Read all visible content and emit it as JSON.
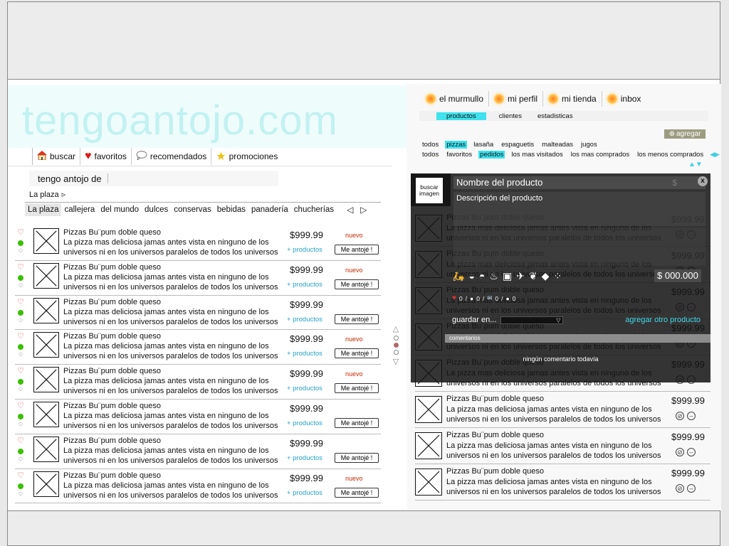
{
  "site": {
    "logo": "tengoantojo.com"
  },
  "nav": [
    {
      "label": "buscar",
      "icon": "home-icon"
    },
    {
      "label": "favoritos",
      "icon": "heart-icon"
    },
    {
      "label": "recomendados",
      "icon": "speech-bubble-icon"
    },
    {
      "label": "promociones",
      "icon": "star-icon"
    }
  ],
  "antojo": {
    "label": "tengo antojo de",
    "value": ""
  },
  "plaza": {
    "label": "La plaza",
    "arrow": "▹"
  },
  "categories": [
    "La plaza",
    "callejera",
    "del mundo",
    "dulces",
    "conservas",
    "bebidas",
    "panadería",
    "chucherías"
  ],
  "category_arrows": {
    "prev": "◁",
    "next": "▷"
  },
  "product": {
    "title": "Pizzas Bu¨pum doble queso",
    "desc": "La pizza mas deliciosa jamas antes vista en ninguno de los universos ni en los universos paralelos de todos los universos",
    "price": "$999.99",
    "plus": "+ productos",
    "nuevo": "nuevo",
    "antoje": "Me antojé !"
  },
  "left_rows": [
    {
      "nuevo": true
    },
    {
      "nuevo": true
    },
    {
      "nuevo": false
    },
    {
      "nuevo": true
    },
    {
      "nuevo": true
    },
    {
      "nuevo": false
    },
    {
      "nuevo": false
    },
    {
      "nuevo": true
    }
  ],
  "right_tabs": [
    "el murmullo",
    "mi perfil",
    "mi tienda",
    "inbox"
  ],
  "subtabs": [
    "productos",
    "clientes",
    "estadisticas"
  ],
  "agregar": "agregar",
  "filters_row1": [
    "todos",
    "pizzas",
    "lasaña",
    "espaguetis",
    "malteadas",
    "jugos"
  ],
  "filters_row2": [
    "todos",
    "favoritos",
    "pedidos",
    "los mas visitados",
    "los mas comprados",
    "los menos comprados"
  ],
  "editor": {
    "buscar_imagen": "buscar imagen",
    "nombre": "Nombre del producto",
    "dollar": "$",
    "close": "x",
    "descripcion": "Descripción del producto",
    "price_value": "$ 000.000",
    "stats": [
      "0",
      "0",
      "0",
      "0"
    ],
    "guardar": "guardar en...",
    "agregar_otro": "agregar otro producto",
    "comentarios": "comentarios",
    "ningun": "ningún comentario todavía"
  },
  "colors": {
    "accent": "#3fe2ee",
    "nuevo": "#c62a00",
    "link": "#25a0c8",
    "logo": "#c2f1f1",
    "online": "#39c000"
  }
}
